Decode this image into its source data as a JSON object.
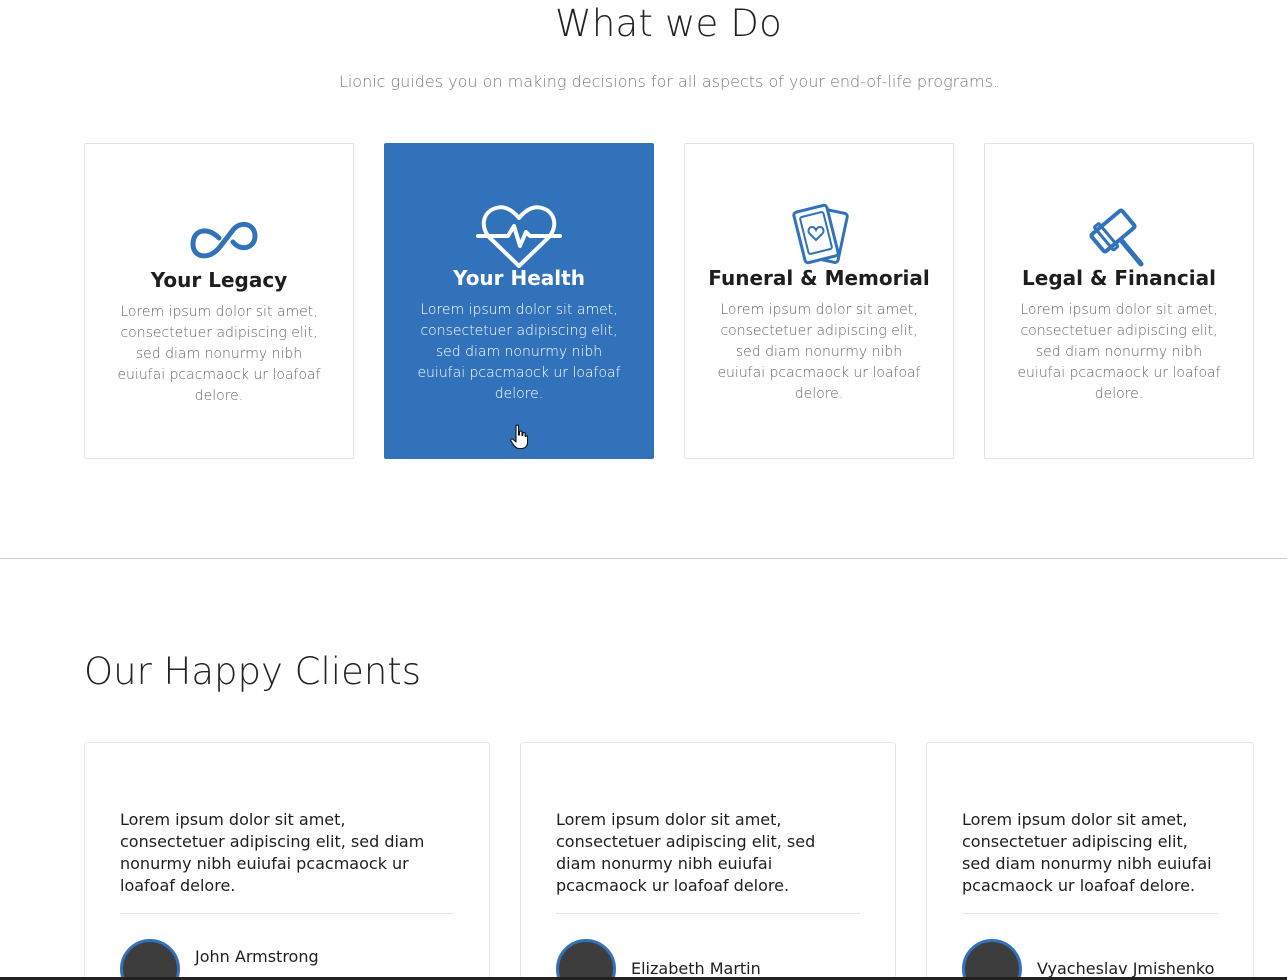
{
  "what_we_do": {
    "title": "What we Do",
    "subtitle": "Lionic guides you on making decisions for all aspects of your end-of-life programs."
  },
  "services": [
    {
      "title": "Your Legacy",
      "text": "Lorem ipsum dolor sit amet, consectetuer adipiscing elit, sed diam nonurmy nibh euiufai pcacmaock ur loafoaf delore.",
      "icon": "infinity-icon",
      "active": false
    },
    {
      "title": "Your Health",
      "text": "Lorem ipsum dolor sit amet, consectetuer adipiscing elit, sed diam nonurmy nibh euiufai pcacmaock ur loafoaf delore.",
      "icon": "heartbeat-icon",
      "active": true
    },
    {
      "title": "Funeral & Memorial",
      "text": "Lorem ipsum dolor sit amet, consectetuer adipiscing elit, sed diam nonurmy nibh euiufai pcacmaock ur loafoaf delore.",
      "icon": "memorial-cards-icon",
      "active": false
    },
    {
      "title": "Legal & Financial",
      "text": "Lorem ipsum dolor sit amet, consectetuer adipiscing elit, sed diam nonurmy nibh euiufai pcacmaock ur loafoaf delore.",
      "icon": "gavel-icon",
      "active": false
    }
  ],
  "clients": {
    "title": "Our Happy Clients",
    "testimonials": [
      {
        "quote": "Lorem ipsum dolor sit amet, consectetuer adipiscing elit, sed diam nonurmy nibh euiufai pcacmaock ur loafoaf delore.",
        "name": "John Armstrong"
      },
      {
        "quote": "Lorem ipsum dolor sit amet, consectetuer adipiscing elit, sed diam nonurmy nibh euiufai pcacmaock ur loafoaf delore.",
        "name": "Elizabeth Martin"
      },
      {
        "quote": "Lorem ipsum dolor sit amet, consectetuer adipiscing elit, sed diam nonurmy nibh euiufai pcacmaock ur loafoaf delore.",
        "name": "Vyacheslav Jmishenko"
      }
    ]
  },
  "colors": {
    "accent": "#3272bb",
    "card_border": "#e2e2e2",
    "muted_text": "#7a7a7a"
  }
}
